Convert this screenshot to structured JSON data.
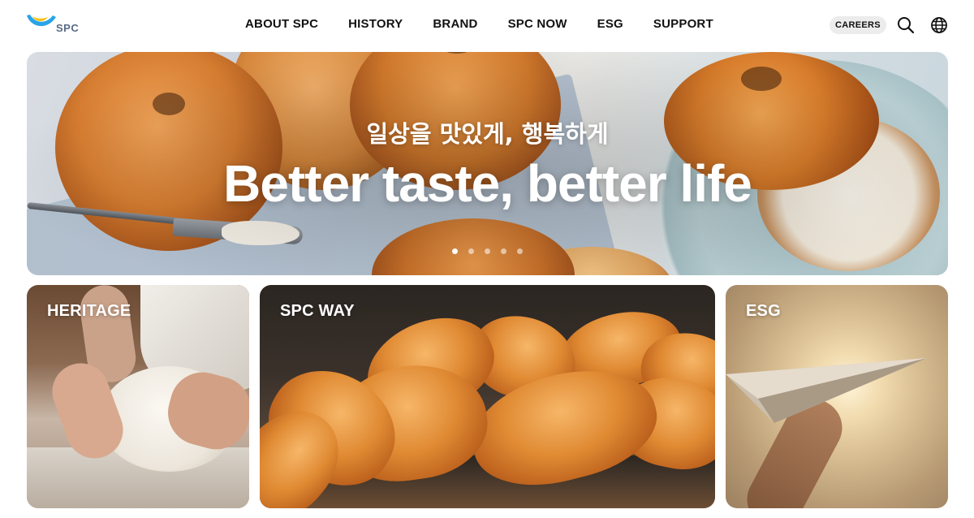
{
  "header": {
    "logo_text": "SPC",
    "nav": [
      {
        "label": "ABOUT SPC"
      },
      {
        "label": "HISTORY"
      },
      {
        "label": "BRAND"
      },
      {
        "label": "SPC NOW"
      },
      {
        "label": "ESG"
      },
      {
        "label": "SUPPORT"
      }
    ],
    "careers_label": "CAREERS",
    "icons": {
      "search": "search-icon",
      "language": "globe-icon"
    },
    "logo_colors": {
      "blue": "#2aa4e8",
      "yellow": "#f6c21b"
    }
  },
  "hero": {
    "subtitle": "일상을 맛있게, 행복하게",
    "title": "Better taste, better life",
    "slide_count": 5,
    "active_slide": 1
  },
  "cards": [
    {
      "label": "HERITAGE"
    },
    {
      "label": "SPC WAY"
    },
    {
      "label": "ESG"
    }
  ]
}
